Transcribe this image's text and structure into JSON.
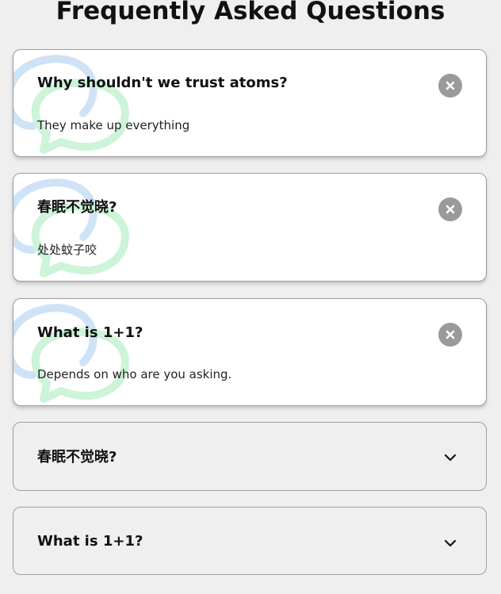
{
  "page": {
    "title": "Frequently Asked Questions"
  },
  "faqs": [
    {
      "question": "Why shouldn't we trust atoms?",
      "answer": "They make up everything",
      "state": "open",
      "toggle_icon": "close-icon"
    },
    {
      "question": "春眠不觉晓?",
      "answer": "处处蚊子咬",
      "state": "open",
      "toggle_icon": "close-icon"
    },
    {
      "question": "What is 1+1?",
      "answer": "Depends on who are you asking.",
      "state": "open",
      "toggle_icon": "close-icon"
    },
    {
      "question": "春眠不觉晓?",
      "state": "closed",
      "toggle_icon": "chevron-down-icon"
    },
    {
      "question": "What is 1+1?",
      "state": "closed",
      "toggle_icon": "chevron-down-icon"
    }
  ],
  "colors": {
    "background": "#efefef",
    "card_open": "#ffffff",
    "toggle_gray": "#9a9a9a",
    "bubble_blue": "#cfe3f6",
    "bubble_green": "#cdf3d8"
  }
}
